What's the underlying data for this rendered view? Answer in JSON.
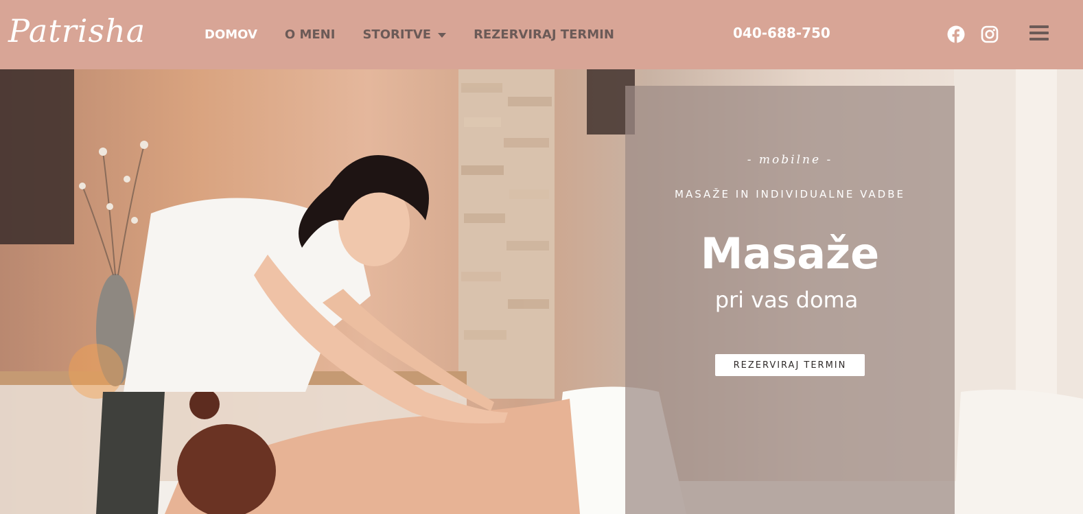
{
  "header": {
    "logo_text": "Patrisha",
    "phone": "040-688-750"
  },
  "nav": {
    "items": [
      {
        "label": "DOMOV",
        "active": true
      },
      {
        "label": "O MENI",
        "active": false
      },
      {
        "label": "STORITVE",
        "active": false,
        "has_dropdown": true
      },
      {
        "label": "REZERVIRAJ TERMIN",
        "active": false
      }
    ]
  },
  "social": {
    "icons": [
      "facebook-icon",
      "instagram-icon"
    ]
  },
  "menu_icon": "hamburger-menu-icon",
  "hero": {
    "eyebrow": "- mobilne -",
    "subtitle": "MASAŽE IN INDIVIDUALNE VADBE",
    "title": "Masaže",
    "title_line2": "pri vas doma",
    "cta_label": "REZERVIRAJ TERMIN"
  },
  "colors": {
    "header_bg": "#d8a596",
    "nav_text": "#6b5a57",
    "active_text": "#ffffff",
    "panel_overlay": "#9e8c86"
  }
}
